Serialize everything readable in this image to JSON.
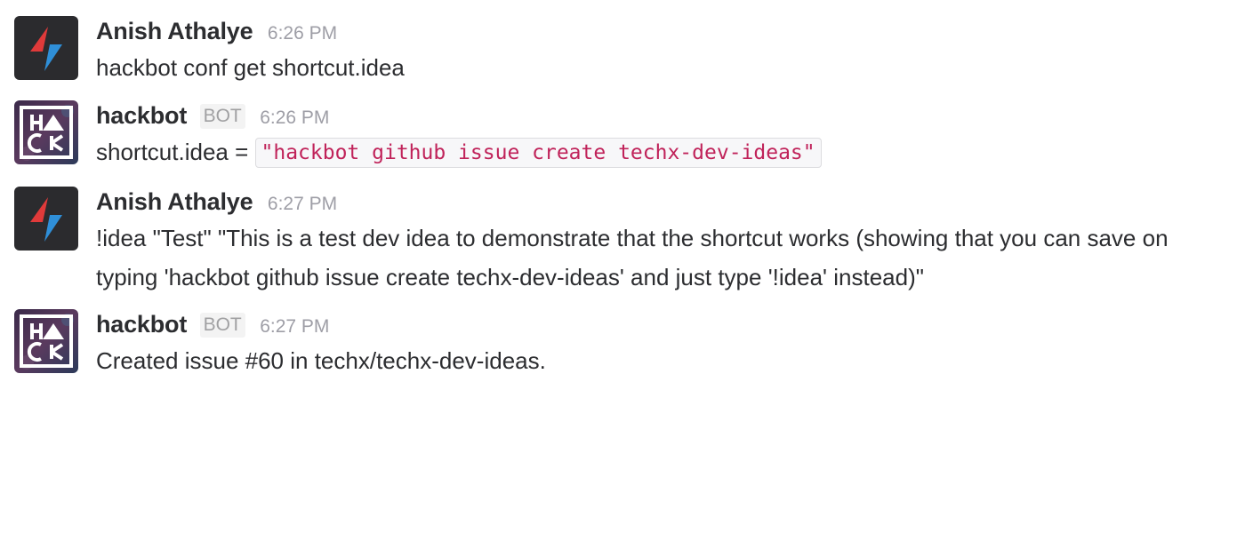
{
  "messages": [
    {
      "avatar_icon": "lightning-bolt-icon",
      "author": "Anish Athalye",
      "time": "6:26 PM",
      "text": "hackbot conf get shortcut.idea"
    },
    {
      "avatar_icon": "hack-logo-icon",
      "author": "hackbot",
      "badge": "BOT",
      "time": "6:26 PM",
      "text_prefix": "shortcut.idea = ",
      "code": "\"hackbot github issue create techx-dev-ideas\""
    },
    {
      "avatar_icon": "lightning-bolt-icon",
      "author": "Anish Athalye",
      "time": "6:27 PM",
      "text": "!idea \"Test\" \"This is a test dev idea to demonstrate that the shortcut works (showing that you can save on typing 'hackbot github issue create techx-dev-ideas' and just type '!idea' instead)\""
    },
    {
      "avatar_icon": "hack-logo-icon",
      "author": "hackbot",
      "badge": "BOT",
      "time": "6:27 PM",
      "text": "Created issue #60 in techx/techx-dev-ideas."
    }
  ],
  "colors": {
    "author": "#2c2d30",
    "timestamp": "#9e9ea6",
    "code_text": "#c0235a",
    "bolt_red": "#e03a3a",
    "bolt_blue": "#2f8fd8",
    "avatar_dark": "#2b2b2e"
  }
}
